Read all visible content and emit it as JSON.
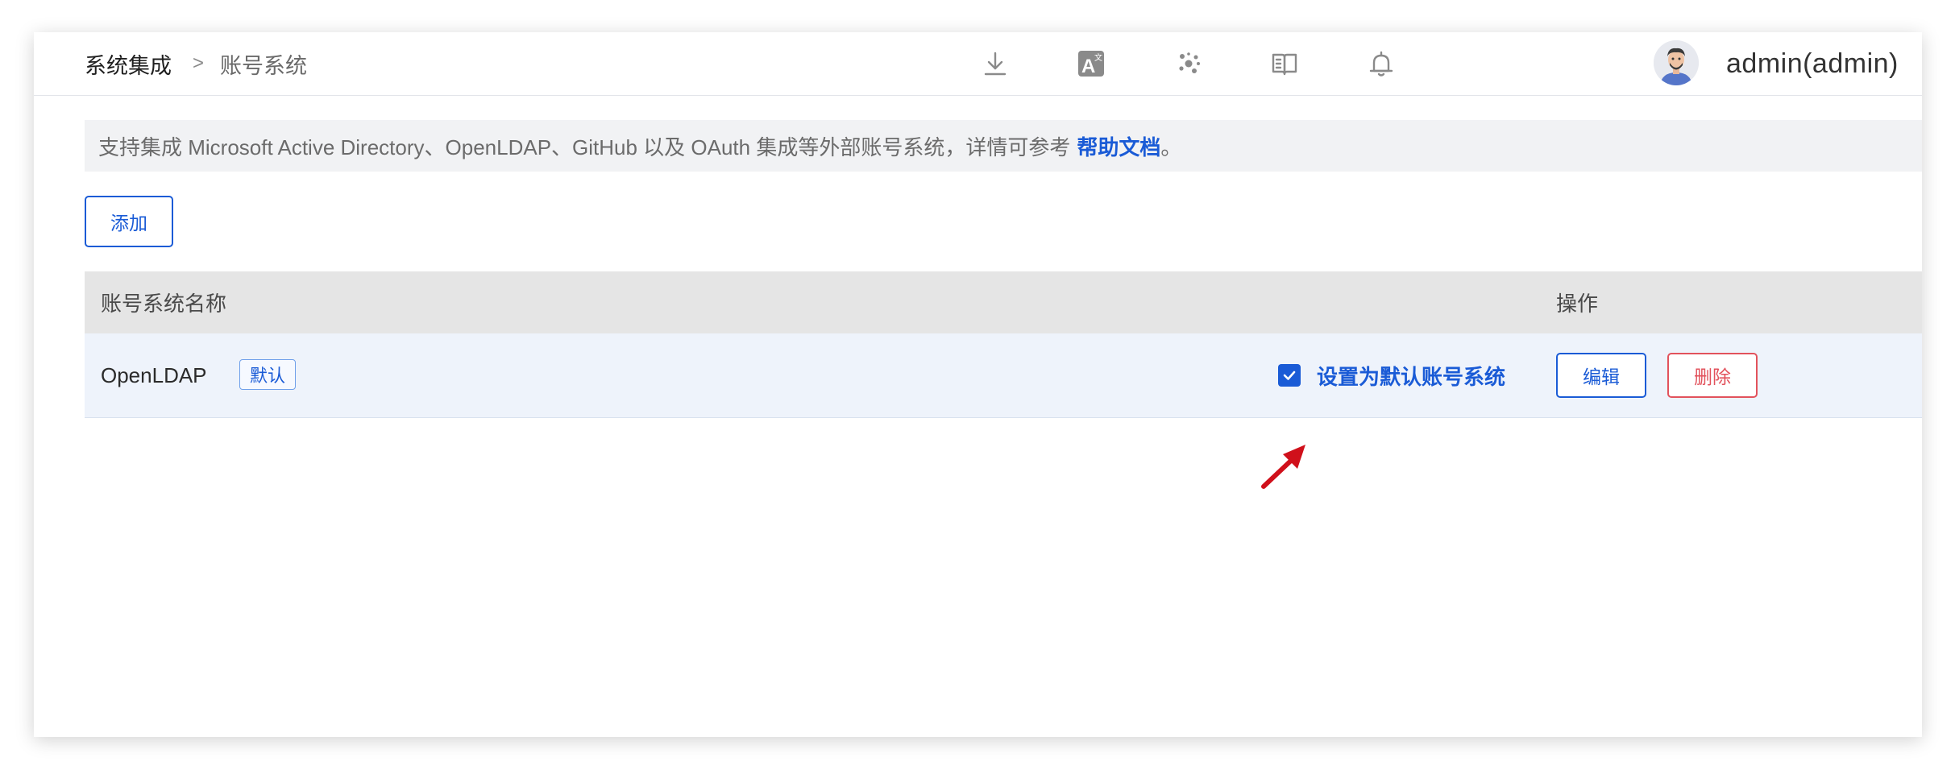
{
  "breadcrumb": {
    "parent": "系统集成",
    "separator": ">",
    "current": "账号系统"
  },
  "header": {
    "icons": [
      "download-icon",
      "translate-icon",
      "apps-icon",
      "docs-icon",
      "bell-icon"
    ],
    "user_name": "admin(admin)"
  },
  "notice": {
    "text": "支持集成 Microsoft Active Directory、OpenLDAP、GitHub 以及 OAuth 集成等外部账号系统，详情可参考",
    "link": "帮助文档",
    "suffix": "。"
  },
  "add_button": "添加",
  "table": {
    "columns": {
      "name": "账号系统名称",
      "ops": "操作"
    },
    "rows": [
      {
        "name": "OpenLDAP",
        "tag": "默认",
        "set_default_label": "设置为默认账号系统",
        "set_default_checked": true,
        "edit_label": "编辑",
        "delete_label": "删除"
      }
    ]
  },
  "colors": {
    "accent": "#1a5bd6",
    "danger": "#e2525c",
    "annotation": "#d0101b"
  }
}
